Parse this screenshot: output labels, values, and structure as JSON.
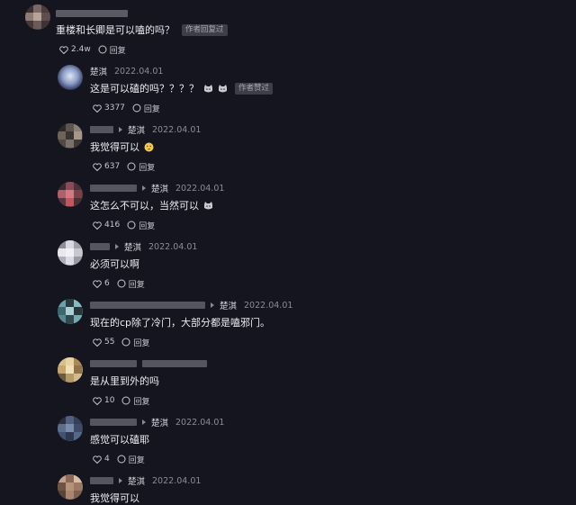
{
  "author_badge": "作者回复过",
  "reply_label": "回复",
  "top_comment": {
    "text": "重楼和长卿是可以嗑的吗？",
    "likes": "2.4w"
  },
  "replies": [
    {
      "author": "楚淇",
      "date": "2022.04.01",
      "text": "这是可以磕的吗？？？？",
      "likes": "3377",
      "author_badge": "作者赞过"
    },
    {
      "reply_to": "楚淇",
      "date": "2022.04.01",
      "text": "我觉得可以",
      "likes": "637"
    },
    {
      "reply_to": "楚淇",
      "date": "2022.04.01",
      "text": "这怎么不可以，当然可以",
      "likes": "416"
    },
    {
      "reply_to": "楚淇",
      "date": "2022.04.01",
      "text": "必须可以啊",
      "likes": "6"
    },
    {
      "reply_to": "楚淇",
      "date": "2022.04.01",
      "text": "现在的cp除了冷门，大部分都是嗑邪门。",
      "likes": "55"
    },
    {
      "text": "是从里到外的吗",
      "likes": "10"
    },
    {
      "reply_to": "楚淇",
      "date": "2022.04.01",
      "text": "感觉可以磕耶",
      "likes": "4"
    },
    {
      "reply_to": "楚淇",
      "date": "2022.04.01",
      "text": "我觉得可以"
    }
  ],
  "colors": {
    "background": "#15151f",
    "badge_bg": "#3e3e4a",
    "meta_text": "#8c8c98"
  }
}
